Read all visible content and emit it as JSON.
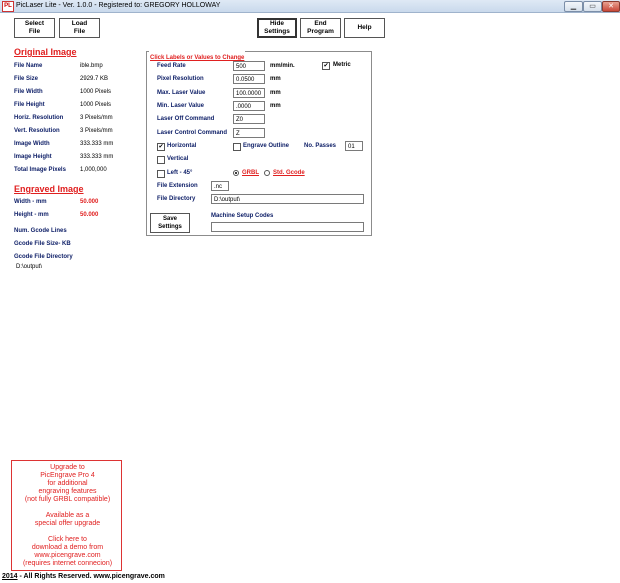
{
  "window": {
    "app_icon": "PL",
    "title": "PicLaser Lite - Ver. 1.0.0 - Registered to: GREGORY HOLLOWAY",
    "minimize_icon": "minimize-icon",
    "maximize_icon": "maximize-icon",
    "close_icon": "close-icon"
  },
  "toolbar": {
    "select_file": "Select File",
    "load_file": "Load File",
    "hide_settings": "Hide Settings",
    "end_program": "End Program",
    "help": "Help"
  },
  "original_image": {
    "heading": "Original Image",
    "rows": [
      {
        "label": "File Name",
        "value": "ible.bmp"
      },
      {
        "label": "File Size",
        "value": "2929.7  KB"
      },
      {
        "label": "File Width",
        "value": "1000  Pixels"
      },
      {
        "label": "File Height",
        "value": "1000  Pixels"
      },
      {
        "label": "Horiz. Resolution",
        "value": "3 Pixels/mm"
      },
      {
        "label": "Vert. Resolution",
        "value": "3 Pixels/mm"
      },
      {
        "label": "Image Width",
        "value": "333.333 mm"
      },
      {
        "label": "Image Height",
        "value": "333.333 mm"
      },
      {
        "label": "Total Image Pixels",
        "value": "1,000,000"
      }
    ]
  },
  "engraved_image": {
    "heading": "Engraved Image",
    "width_label": "Width - mm",
    "width_value": "50.000",
    "height_label": "Height - mm",
    "height_value": "50.000",
    "gcode_lines_label": "Num. Gcode Lines",
    "gcode_size_label": "Gcode File Size- KB",
    "gcode_dir_label": "Gcode File Directory",
    "gcode_dir_value": "D:\\output\\"
  },
  "settings": {
    "heading": "Click Labels or Values to Change",
    "feed_rate_label": "Feed Rate",
    "feed_rate_value": "500",
    "feed_rate_unit": "mm/min.",
    "metric_label": "Metric",
    "metric_checked": "✔",
    "pixel_res_label": "Pixel Resolution",
    "pixel_res_value": "0.0500",
    "pixel_res_unit": "mm",
    "max_laser_label": "Max. Laser Value",
    "max_laser_value": "100.0000",
    "max_laser_unit": "mm",
    "min_laser_label": "Min. Laser Value",
    "min_laser_value": ".0000",
    "min_laser_unit": "mm",
    "laser_off_label": "Laser Off Command",
    "laser_off_value": "Z0",
    "laser_control_label": "Laser Control Command",
    "laser_control_value": "Z",
    "horizontal_label": "Horizontal",
    "horizontal_checked": "✔",
    "engrave_outline_label": "Engrave Outline",
    "no_passes_label": "No. Passes",
    "no_passes_value": "01",
    "vertical_label": "Vertical",
    "left45_label": "Left - 45°",
    "grbl_label": "GRBL",
    "std_gcode_label": "Std. Gcode",
    "file_ext_label": "File Extension",
    "file_ext_value": ".nc",
    "file_dir_label": "File Directory",
    "file_dir_value": "D:\\output\\",
    "save_label": "Save Settings",
    "machine_setup_label": "Machine Setup Codes",
    "machine_setup_value": ""
  },
  "upgrade": {
    "lines": [
      "Upgrade  to",
      "PicEngrave Pro 4",
      "for additional",
      "engraving  features",
      "(not fully GRBL compatible)",
      "",
      "Available as a",
      "special offer upgrade",
      "",
      "Click here to",
      "download a demo from",
      "www.picengrave.com",
      "(requires internet connecion)"
    ]
  },
  "footer": {
    "year": "2014",
    "text": " - All Rights Reserved.  www.picengrave.com"
  }
}
